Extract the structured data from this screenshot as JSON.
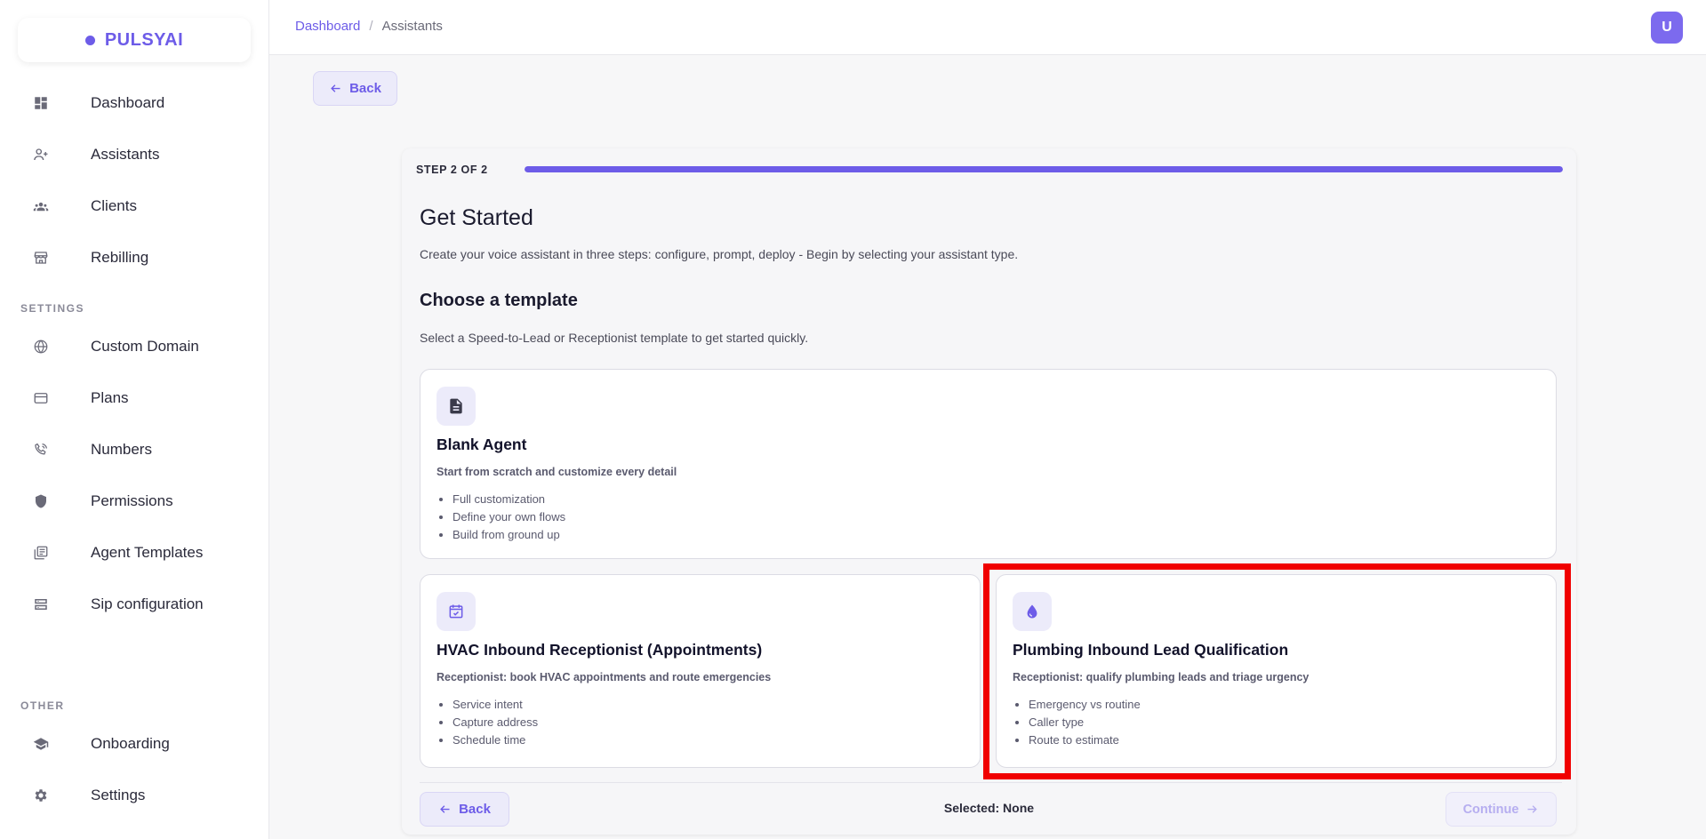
{
  "brand": {
    "name": "PULSYAI",
    "accent": "#6d5ce8"
  },
  "sidebar": {
    "main_items": [
      {
        "label": "Dashboard",
        "icon": "dashboard-icon"
      },
      {
        "label": "Assistants",
        "icon": "person-add-icon"
      },
      {
        "label": "Clients",
        "icon": "group-icon"
      },
      {
        "label": "Rebilling",
        "icon": "storefront-icon"
      }
    ],
    "settings_label": "SETTINGS",
    "settings_items": [
      {
        "label": "Custom Domain",
        "icon": "globe-icon"
      },
      {
        "label": "Plans",
        "icon": "credit-card-icon"
      },
      {
        "label": "Numbers",
        "icon": "phone-icon"
      },
      {
        "label": "Permissions",
        "icon": "shield-icon"
      },
      {
        "label": "Agent Templates",
        "icon": "library-icon"
      },
      {
        "label": "Sip configuration",
        "icon": "server-icon"
      }
    ],
    "other_label": "OTHER",
    "other_items": [
      {
        "label": "Onboarding",
        "icon": "graduation-cap-icon"
      },
      {
        "label": "Settings",
        "icon": "gear-icon"
      }
    ]
  },
  "header": {
    "breadcrumb": {
      "root": "Dashboard",
      "separator": "/",
      "current": "Assistants"
    },
    "avatar_initial": "U"
  },
  "top_back_label": "Back",
  "wizard": {
    "step_label": "STEP 2 OF 2",
    "progress": 1.0,
    "title": "Get Started",
    "subtitle": "Create your voice assistant in three steps: configure, prompt, deploy - Begin by selecting your assistant type.",
    "section_title": "Choose a template",
    "section_subtitle": "Select a Speed-to-Lead or Receptionist template to get started quickly.",
    "templates": [
      {
        "title": "Blank Agent",
        "icon": "document-icon",
        "description": "Start from scratch and customize every detail",
        "bullets": [
          "Full customization",
          "Define your own flows",
          "Build from ground up"
        ]
      },
      {
        "title": "HVAC Inbound Receptionist (Appointments)",
        "icon": "calendar-check-icon",
        "description": "Receptionist: book HVAC appointments and route emergencies",
        "bullets": [
          "Service intent",
          "Capture address",
          "Schedule time"
        ]
      },
      {
        "title": "Plumbing Inbound Lead Qualification",
        "icon": "water-drop-icon",
        "description": "Receptionist: qualify plumbing leads and triage urgency",
        "bullets": [
          "Emergency vs routine",
          "Caller type",
          "Route to estimate"
        ]
      }
    ],
    "footer": {
      "back_label": "Back",
      "selected_text": "Selected: None",
      "continue_label": "Continue"
    }
  }
}
